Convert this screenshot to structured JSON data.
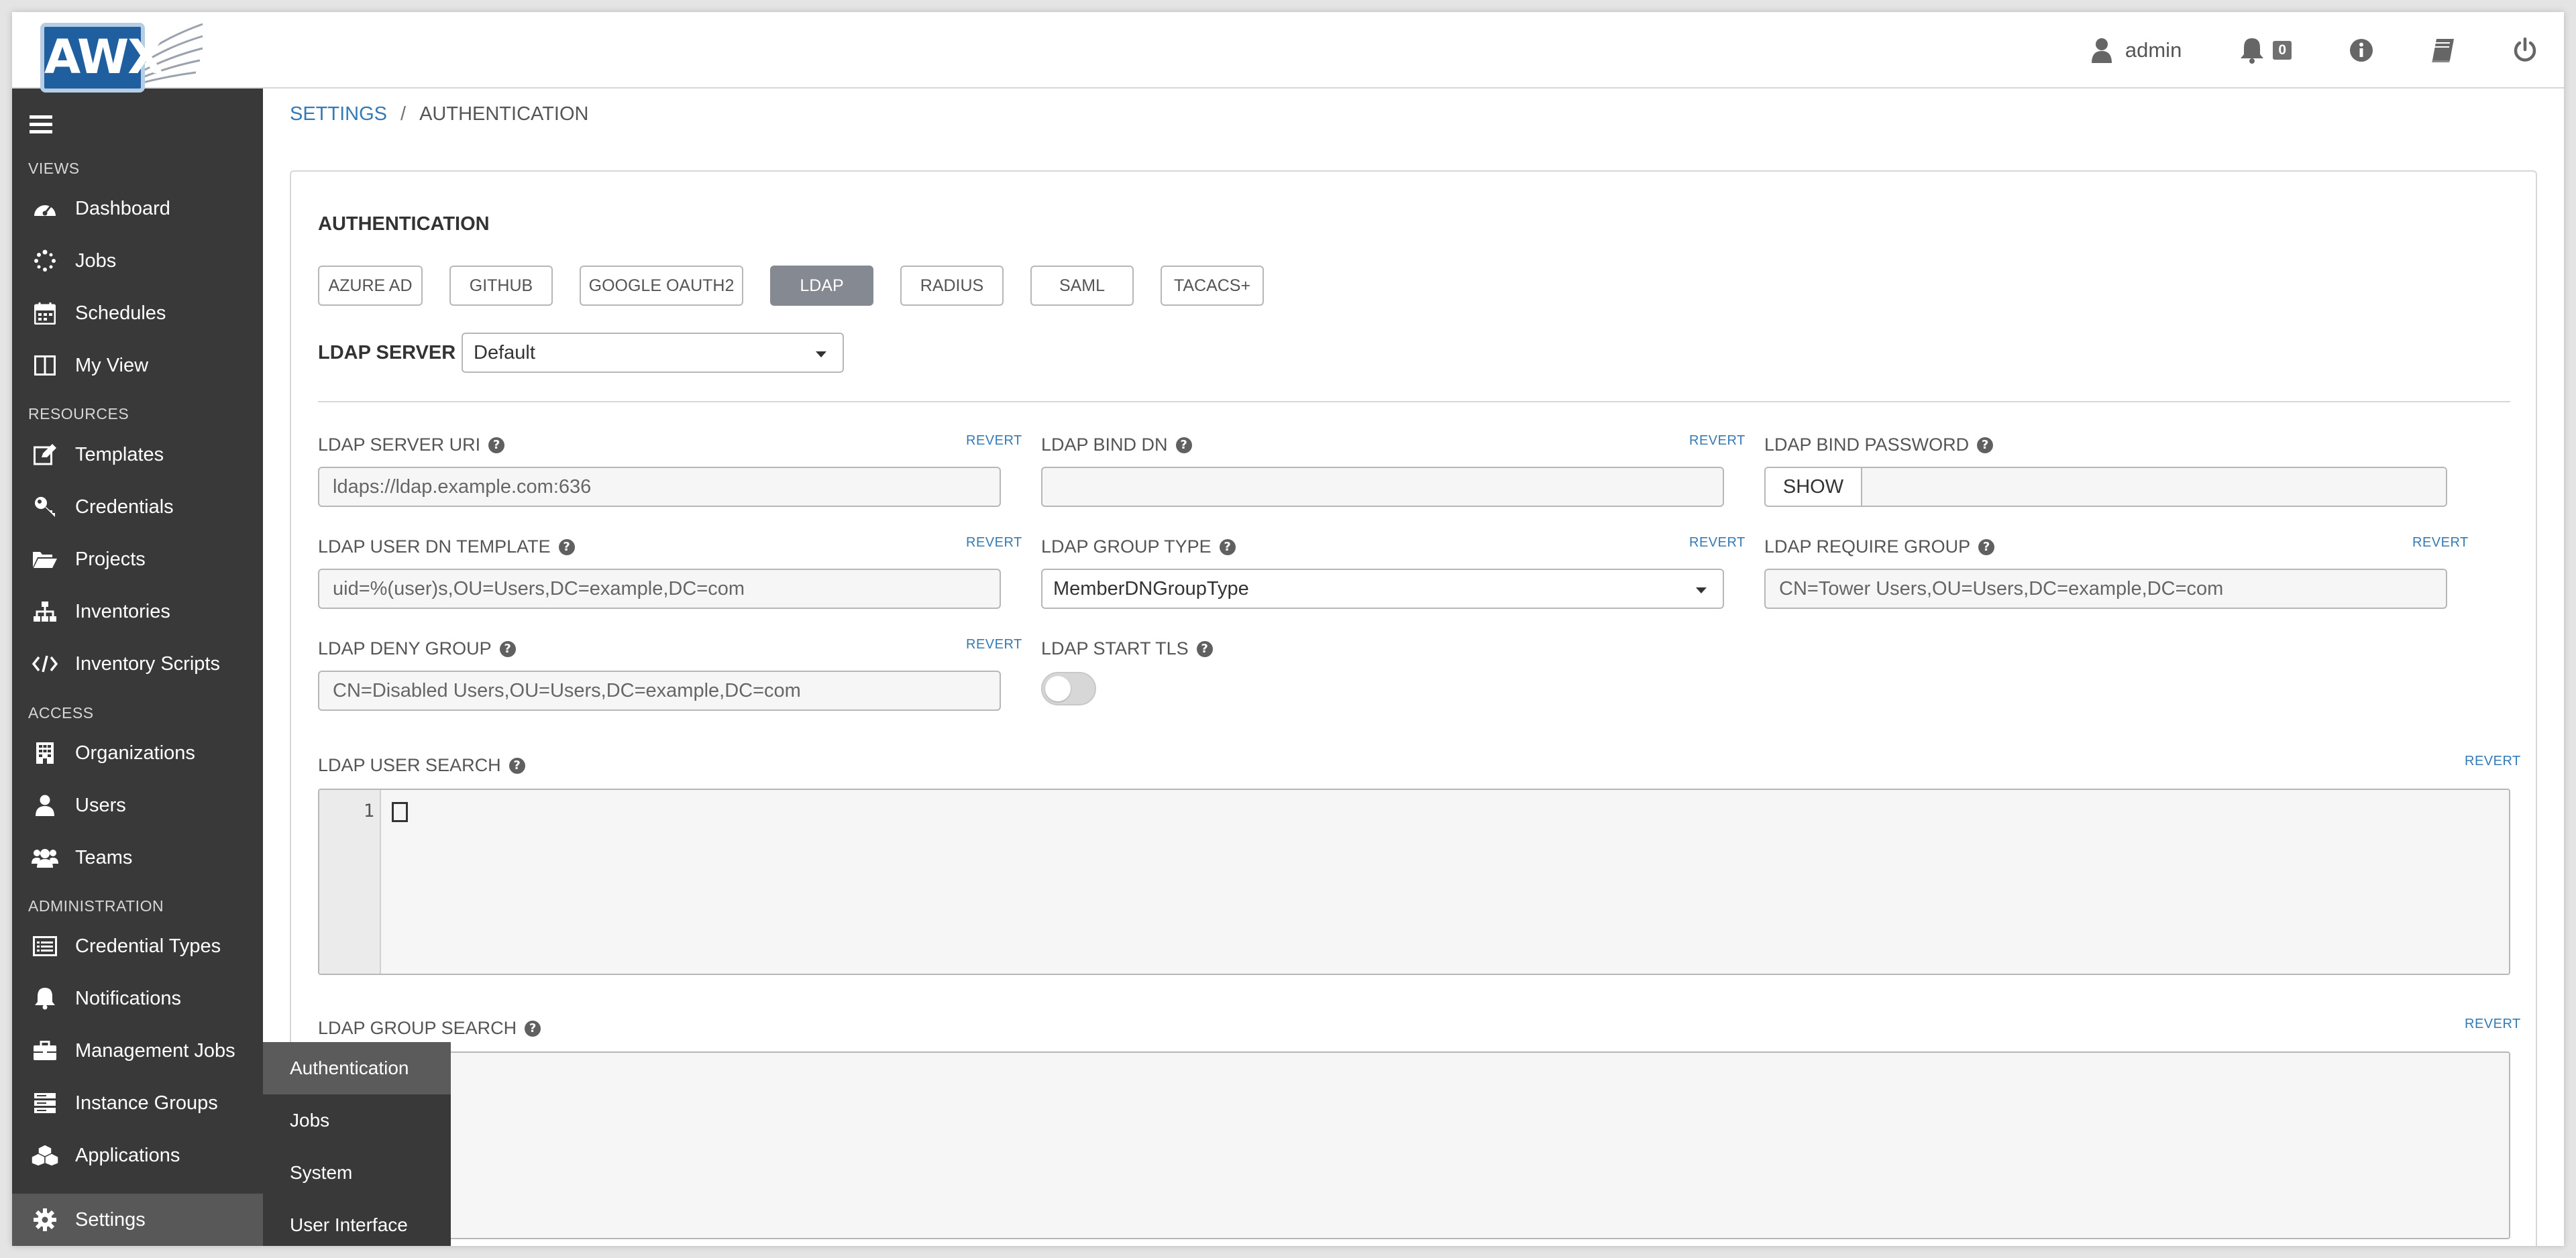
{
  "app": {
    "logo_text": "AWX"
  },
  "header": {
    "user": "admin",
    "notification_count": "0"
  },
  "sidebar": {
    "sections": {
      "views": "VIEWS",
      "resources": "RESOURCES",
      "access": "ACCESS",
      "administration": "ADMINISTRATION"
    },
    "items": [
      {
        "label": "Dashboard",
        "icon": "dashboard-icon"
      },
      {
        "label": "Jobs",
        "icon": "jobs-spinner-icon"
      },
      {
        "label": "Schedules",
        "icon": "calendar-icon"
      },
      {
        "label": "My View",
        "icon": "columns-icon"
      },
      {
        "label": "Templates",
        "icon": "edit-icon"
      },
      {
        "label": "Credentials",
        "icon": "key-icon"
      },
      {
        "label": "Projects",
        "icon": "folder-icon"
      },
      {
        "label": "Inventories",
        "icon": "sitemap-icon"
      },
      {
        "label": "Inventory Scripts",
        "icon": "code-icon"
      },
      {
        "label": "Organizations",
        "icon": "building-icon"
      },
      {
        "label": "Users",
        "icon": "user-icon"
      },
      {
        "label": "Teams",
        "icon": "users-icon"
      },
      {
        "label": "Credential Types",
        "icon": "list-alt-icon"
      },
      {
        "label": "Notifications",
        "icon": "bell-icon"
      },
      {
        "label": "Management Jobs",
        "icon": "briefcase-icon"
      },
      {
        "label": "Instance Groups",
        "icon": "server-icon"
      },
      {
        "label": "Applications",
        "icon": "cubes-icon"
      },
      {
        "label": "Settings",
        "icon": "gear-icon"
      }
    ]
  },
  "submenu": {
    "items": [
      "Authentication",
      "Jobs",
      "System",
      "User Interface"
    ],
    "active": "Authentication"
  },
  "breadcrumb": {
    "parent": "SETTINGS",
    "separator": "/",
    "current": "AUTHENTICATION"
  },
  "auth": {
    "title": "AUTHENTICATION",
    "tabs": [
      "AZURE AD",
      "GITHUB",
      "GOOGLE OAUTH2",
      "LDAP",
      "RADIUS",
      "SAML",
      "TACACS+"
    ],
    "active_tab": "LDAP",
    "server_label": "LDAP SERVER",
    "server_value": "Default",
    "revert_label": "REVERT",
    "fields": {
      "server_uri": {
        "label": "LDAP SERVER URI",
        "value": "ldaps://ldap.example.com:636"
      },
      "bind_dn": {
        "label": "LDAP BIND DN",
        "value": ""
      },
      "bind_password": {
        "label": "LDAP BIND PASSWORD",
        "show_label": "SHOW",
        "value": ""
      },
      "user_dn_template": {
        "label": "LDAP USER DN TEMPLATE",
        "value": "uid=%(user)s,OU=Users,DC=example,DC=com"
      },
      "group_type": {
        "label": "LDAP GROUP TYPE",
        "value": "MemberDNGroupType"
      },
      "require_group": {
        "label": "LDAP REQUIRE GROUP",
        "value": "CN=Tower Users,OU=Users,DC=example,DC=com"
      },
      "deny_group": {
        "label": "LDAP DENY GROUP",
        "value": "CN=Disabled Users,OU=Users,DC=example,DC=com"
      },
      "start_tls": {
        "label": "LDAP START TLS",
        "enabled": false
      },
      "user_search": {
        "label": "LDAP USER SEARCH",
        "line_number": "1"
      },
      "group_search": {
        "label": "LDAP GROUP SEARCH"
      }
    }
  },
  "colors": {
    "sidebar_bg": "#393939",
    "active_tab": "#848992",
    "link": "#337ab7",
    "logo": "#1f5fa0"
  }
}
